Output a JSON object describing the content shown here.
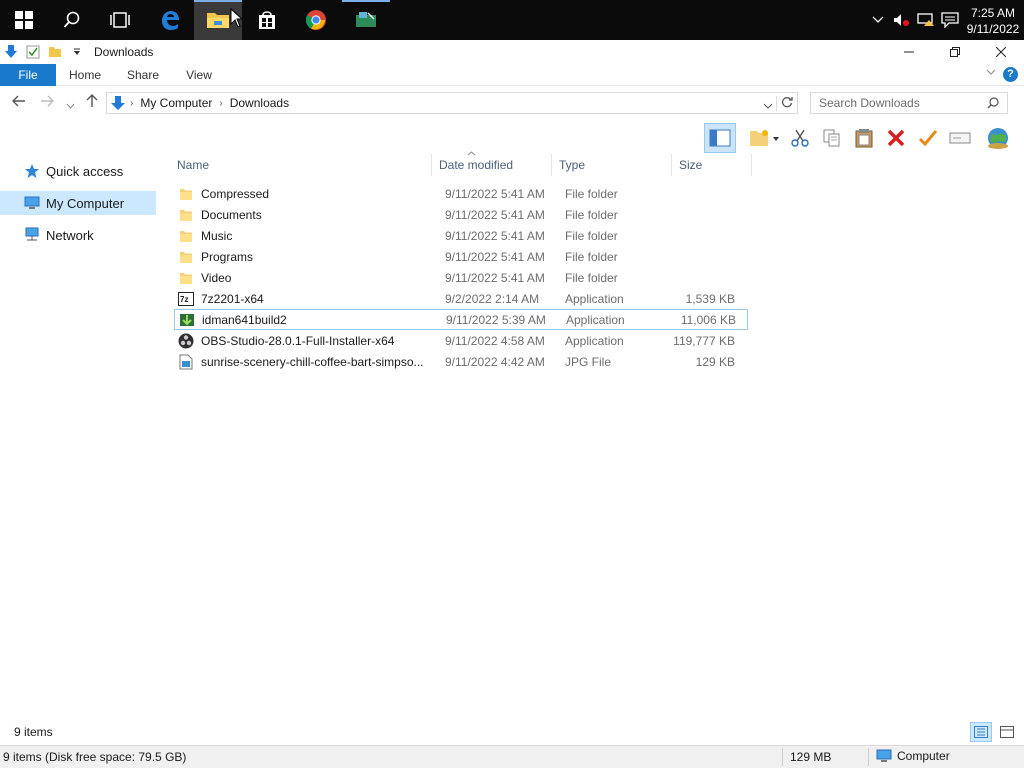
{
  "taskbar": {
    "apps": [
      {
        "name": "start"
      },
      {
        "name": "search"
      },
      {
        "name": "task-view"
      },
      {
        "name": "edge"
      },
      {
        "name": "file-explorer",
        "active": true
      },
      {
        "name": "store"
      },
      {
        "name": "chrome"
      },
      {
        "name": "app"
      }
    ],
    "time": "7:25 AM",
    "date": "9/11/2022"
  },
  "window": {
    "title": "Downloads",
    "ribbon_tabs": [
      "File",
      "Home",
      "Share",
      "View"
    ]
  },
  "address": {
    "crumbs": [
      "My Computer",
      "Downloads"
    ],
    "search_placeholder": "Search Downloads"
  },
  "nav": {
    "items": [
      {
        "label": "Quick access",
        "icon": "star-icon"
      },
      {
        "label": "My Computer",
        "icon": "computer-icon",
        "selected": true
      },
      {
        "label": "Network",
        "icon": "network-icon"
      }
    ]
  },
  "columns": {
    "name": "Name",
    "date": "Date modified",
    "type": "Type",
    "size": "Size"
  },
  "files": [
    {
      "name": "Compressed",
      "date": "9/11/2022 5:41 AM",
      "type": "File folder",
      "size": "",
      "icon": "folder-icon"
    },
    {
      "name": "Documents",
      "date": "9/11/2022 5:41 AM",
      "type": "File folder",
      "size": "",
      "icon": "folder-icon"
    },
    {
      "name": "Music",
      "date": "9/11/2022 5:41 AM",
      "type": "File folder",
      "size": "",
      "icon": "folder-icon"
    },
    {
      "name": "Programs",
      "date": "9/11/2022 5:41 AM",
      "type": "File folder",
      "size": "",
      "icon": "folder-icon"
    },
    {
      "name": "Video",
      "date": "9/11/2022 5:41 AM",
      "type": "File folder",
      "size": "",
      "icon": "folder-icon"
    },
    {
      "name": "7z2201-x64",
      "date": "9/2/2022 2:14 AM",
      "type": "Application",
      "size": "1,539 KB",
      "icon": "7zip-icon"
    },
    {
      "name": "idman641build2",
      "date": "9/11/2022 5:39 AM",
      "type": "Application",
      "size": "11,006 KB",
      "icon": "idm-icon",
      "hover": true
    },
    {
      "name": "OBS-Studio-28.0.1-Full-Installer-x64",
      "date": "9/11/2022 4:58 AM",
      "type": "Application",
      "size": "119,777 KB",
      "icon": "obs-icon"
    },
    {
      "name": "sunrise-scenery-chill-coffee-bart-simpso...",
      "date": "9/11/2022 4:42 AM",
      "type": "JPG File",
      "size": "129 KB",
      "icon": "image-file-icon"
    }
  ],
  "footer": {
    "item_count": "9 items",
    "status_left": "9 items (Disk free space: 79.5 GB)",
    "status_size": "129 MB",
    "status_location": "Computer"
  }
}
